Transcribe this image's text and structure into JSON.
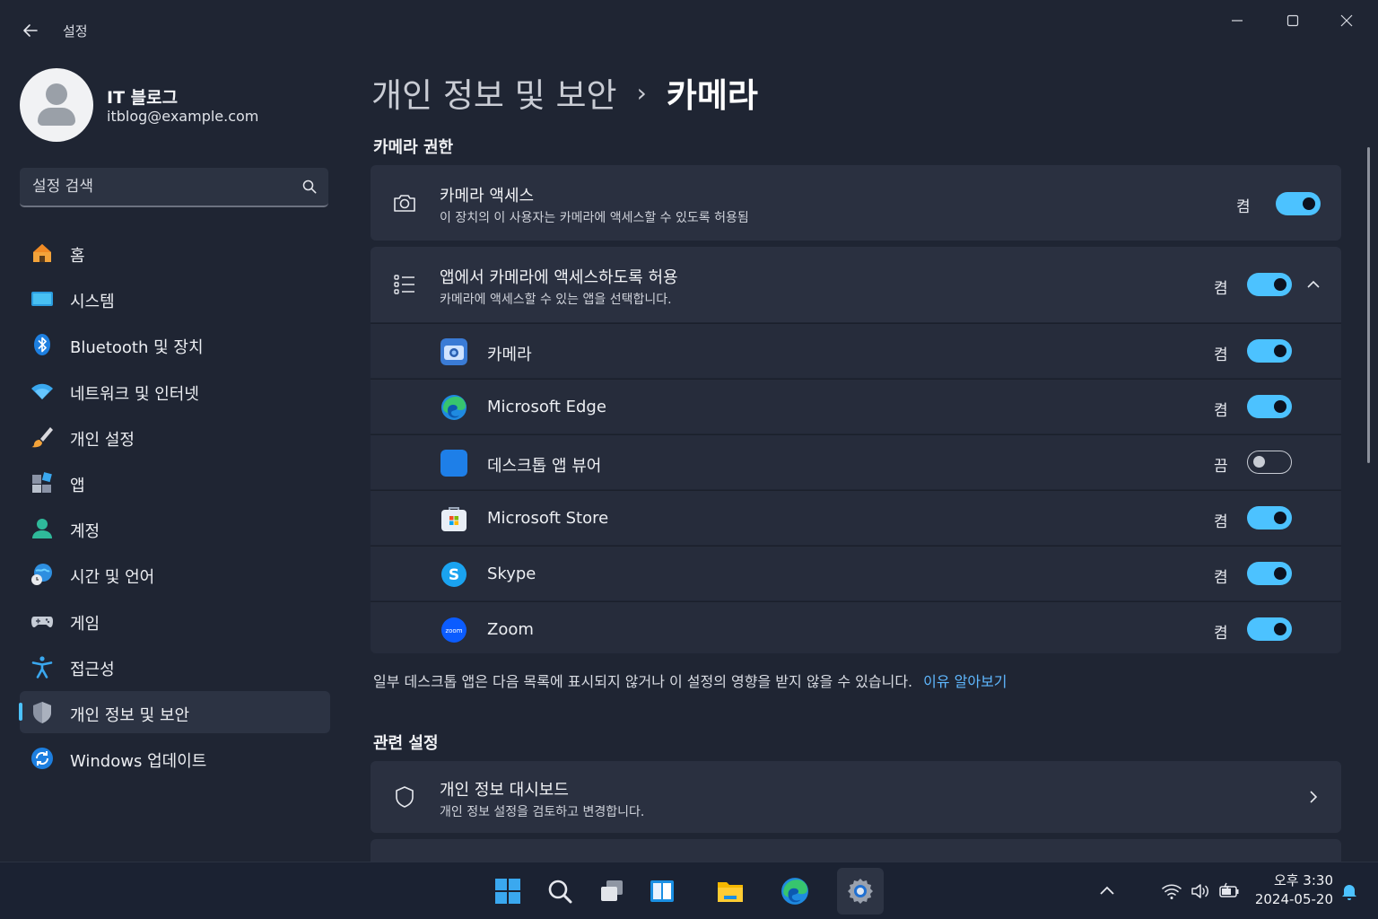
{
  "window": {
    "title": "설정",
    "controls": [
      "minimize",
      "maximize",
      "close"
    ]
  },
  "profile": {
    "name": "IT 블로그",
    "email": "itblog@example.com"
  },
  "search": {
    "placeholder": "설정 검색"
  },
  "sidebar": {
    "items": [
      {
        "label": "홈",
        "icon": "home-icon",
        "active": false
      },
      {
        "label": "시스템",
        "icon": "system-icon",
        "active": false
      },
      {
        "label": "Bluetooth 및 장치",
        "icon": "bluetooth-icon",
        "active": false
      },
      {
        "label": "네트워크 및 인터넷",
        "icon": "wifi-icon",
        "active": false
      },
      {
        "label": "개인 설정",
        "icon": "brush-icon",
        "active": false
      },
      {
        "label": "앱",
        "icon": "apps-icon",
        "active": false
      },
      {
        "label": "계정",
        "icon": "account-icon",
        "active": false
      },
      {
        "label": "시간 및 언어",
        "icon": "globe-clock-icon",
        "active": false
      },
      {
        "label": "게임",
        "icon": "gamepad-icon",
        "active": false
      },
      {
        "label": "접근성",
        "icon": "accessibility-icon",
        "active": false
      },
      {
        "label": "개인 정보 및 보안",
        "icon": "shield-icon",
        "active": true
      },
      {
        "label": "Windows 업데이트",
        "icon": "update-icon",
        "active": false
      }
    ]
  },
  "breadcrumb": {
    "parent": "개인 정보 및 보안",
    "separator": "›",
    "current": "카메라"
  },
  "permissions": {
    "section_title": "카메라 권한",
    "camera_access": {
      "title": "카메라 액세스",
      "description": "이 장치의 이 사용자는 카메라에 액세스할 수 있도록 허용됨",
      "state": "켬",
      "on": true
    },
    "app_access": {
      "title": "앱에서 카메라에 액세스하도록 허용",
      "description": "카메라에 액세스할 수 있는 앱을 선택합니다.",
      "state": "켬",
      "on": true,
      "expanded": true
    },
    "apps": [
      {
        "name": "카메라",
        "state": "켬",
        "on": true,
        "icon": "camera-app-icon"
      },
      {
        "name": "Microsoft Edge",
        "state": "켬",
        "on": true,
        "icon": "edge-icon"
      },
      {
        "name": "데스크톱 앱 뷰어",
        "state": "끔",
        "on": false,
        "icon": "desktop-app-viewer-icon"
      },
      {
        "name": "Microsoft Store",
        "state": "켬",
        "on": true,
        "icon": "store-icon"
      },
      {
        "name": "Skype",
        "state": "켬",
        "on": true,
        "icon": "skype-icon"
      },
      {
        "name": "Zoom",
        "state": "켬",
        "on": true,
        "icon": "zoom-icon",
        "icon_text": "zoom"
      }
    ],
    "note": "일부 데스크톱 앱은 다음 목록에 표시되지 않거나 이 설정의 영향을 받지 않을 수 있습니다.",
    "note_link": "이유 알아보기"
  },
  "related": {
    "section_title": "관련 설정",
    "dashboard": {
      "title": "개인 정보 대시보드",
      "description": "개인 정보 설정을 검토하고 변경합니다."
    }
  },
  "taskbar": {
    "apps": [
      "start-icon",
      "search-icon",
      "task-view-icon",
      "widgets-icon",
      "file-explorer-icon",
      "edge-icon",
      "settings-icon"
    ],
    "active_app": "settings-icon",
    "clock_time": "오후 3:30",
    "clock_date": "2024-05-20"
  },
  "colors": {
    "accent": "#4cc2ff",
    "window_bg": "#1f2533",
    "card_bg": "#2a3040",
    "link": "#5fb8ff"
  }
}
